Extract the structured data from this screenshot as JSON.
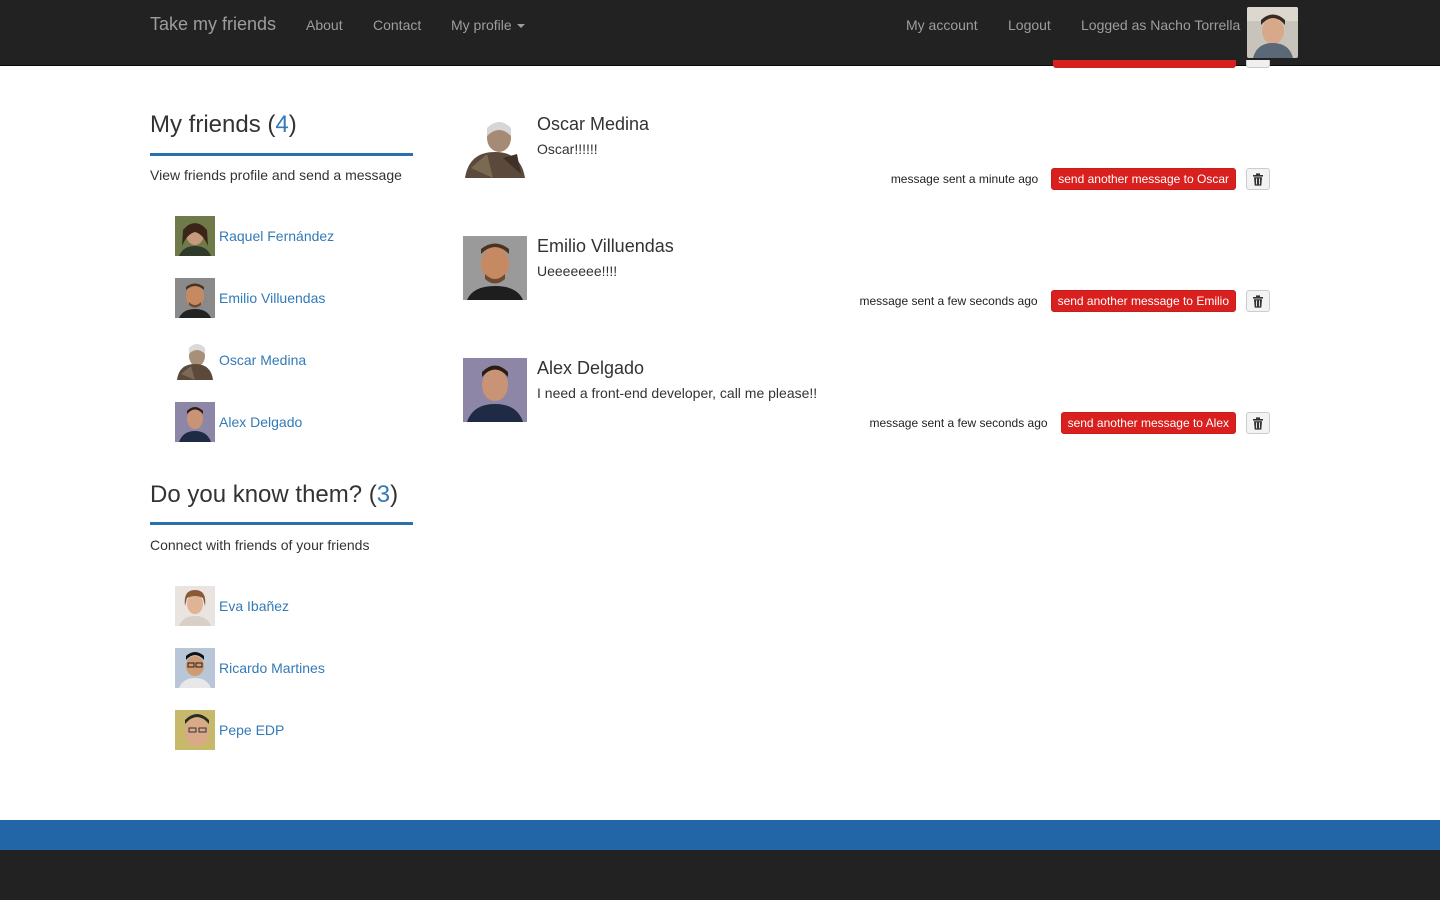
{
  "navbar": {
    "brand": "Take my friends",
    "links": [
      "About",
      "Contact",
      "My profile"
    ],
    "my_account": "My account",
    "logout": "Logout",
    "logged_as": "Logged as Nacho Torrella"
  },
  "sidebar": {
    "friends": {
      "title": "My friends (",
      "count": "4",
      "close": ")",
      "subtitle": "View friends profile and send a message",
      "people": [
        "Raquel Fernández",
        "Emilio Villuendas",
        "Oscar Medina",
        "Alex Delgado"
      ]
    },
    "suggestions": {
      "title": "Do you know them? (",
      "count": "3",
      "close": ")",
      "subtitle": "Connect with friends of your friends",
      "people": [
        "Eva Ibañez",
        "Ricardo Martines",
        "Pepe EDP"
      ]
    }
  },
  "messages": [
    {
      "name": "Oscar Medina",
      "text": "Oscar!!!!!!",
      "time": "message sent a minute ago",
      "button": "send another message to Oscar"
    },
    {
      "name": "Emilio Villuendas",
      "text": "Ueeeeeee!!!!",
      "time": "message sent a few seconds ago",
      "button": "send another message to Emilio"
    },
    {
      "name": "Alex Delgado",
      "text": "I need a front-end developer, call me please!!",
      "time": "message sent a few seconds ago",
      "button": "send another message to Alex"
    }
  ],
  "colors": {
    "navbar_bg": "#222222",
    "link": "#337ab7",
    "accent_rule": "#2c6fad",
    "danger_button": "#d9201f",
    "footer_blue": "#2266a8",
    "footer_dark": "#222222"
  },
  "icons": [
    "caret-down-icon",
    "trash-icon"
  ]
}
